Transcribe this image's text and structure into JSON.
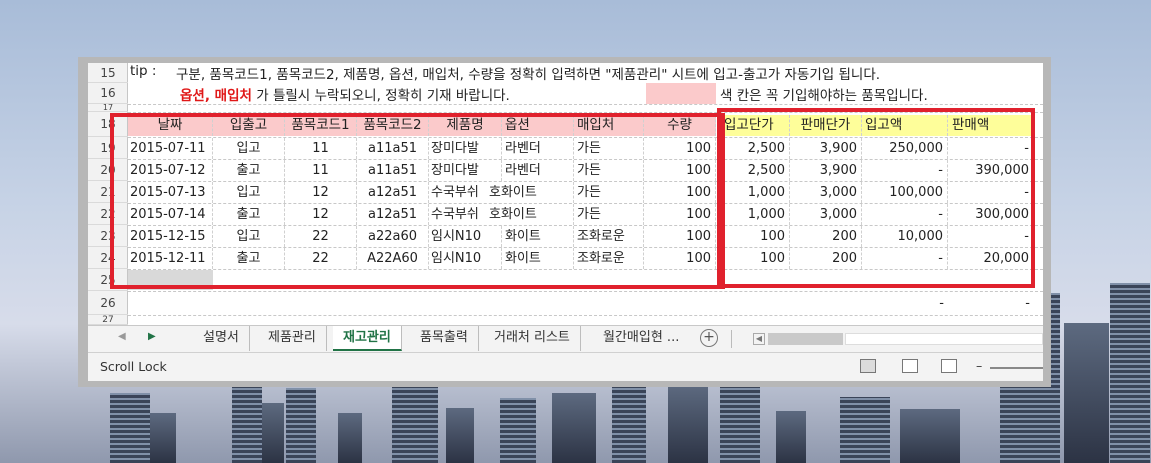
{
  "tip_label": "tip  :",
  "tip_line1": "구분, 품목코드1, 품목코드2, 제품명, 옵션, 매입처, 수량을 정확히 입력하면 \"제품관리\" 시트에 입고-출고가 자동기입 됩니다.",
  "tip_line2_red": "옵션, 매입처",
  "tip_line2_rest": " 가 틀릴시 누락되오니, 정확히 기재 바랍니다.",
  "tip_line2_right": "색 칸은 꼭 기입해야하는 품목입니다.",
  "row_numbers": [
    "15",
    "16",
    "17",
    "18",
    "19",
    "20",
    "21",
    "22",
    "23",
    "24",
    "25",
    "26",
    "27"
  ],
  "headers": {
    "date": "날짜",
    "inout": "입출고",
    "code1": "품목코드1",
    "code2": "품목코드2",
    "product": "제품명",
    "option": "옵션",
    "vendor": "매입처",
    "qty": "수량",
    "in_price": "입고단가",
    "sale_price": "판매단가",
    "in_amount": "입고액",
    "sale_amount": "판매액"
  },
  "rows": [
    {
      "date": "2015-07-11",
      "inout": "입고",
      "code1": "11",
      "code2": "a11a51",
      "product": "장미다발",
      "option": "라벤더",
      "vendor": "가든",
      "qty": "100",
      "in_price": "2,500",
      "sale_price": "3,900",
      "in_amount": "250,000",
      "sale_amount": "-"
    },
    {
      "date": "2015-07-12",
      "inout": "출고",
      "code1": "11",
      "code2": "a11a51",
      "product": "장미다발",
      "option": "라벤더",
      "vendor": "가든",
      "qty": "100",
      "in_price": "2,500",
      "sale_price": "3,900",
      "in_amount": "-",
      "sale_amount": "390,000"
    },
    {
      "date": "2015-07-13",
      "inout": "입고",
      "code1": "12",
      "code2": "a12a51",
      "product": "수국부쉬",
      "option": "호화이트",
      "vendor": "가든",
      "qty": "100",
      "in_price": "1,000",
      "sale_price": "3,000",
      "in_amount": "100,000",
      "sale_amount": "-"
    },
    {
      "date": "2015-07-14",
      "inout": "출고",
      "code1": "12",
      "code2": "a12a51",
      "product": "수국부쉬",
      "option": "호화이트",
      "vendor": "가든",
      "qty": "100",
      "in_price": "1,000",
      "sale_price": "3,000",
      "in_amount": "-",
      "sale_amount": "300,000"
    },
    {
      "date": "2015-12-15",
      "inout": "입고",
      "code1": "22",
      "code2": "a22a60",
      "product": "임시N10",
      "option": "화이트",
      "vendor": "조화로운",
      "qty": "100",
      "in_price": "100",
      "sale_price": "200",
      "in_amount": "10,000",
      "sale_amount": "-"
    },
    {
      "date": "2015-12-11",
      "inout": "출고",
      "code1": "22",
      "code2": "A22A60",
      "product": "임시N10",
      "option": "화이트",
      "vendor": "조화로운",
      "qty": "100",
      "in_price": "100",
      "sale_price": "200",
      "in_amount": "-",
      "sale_amount": "20,000"
    }
  ],
  "row26": {
    "in_amount": "-",
    "sale_amount": "-"
  },
  "tabs": [
    "설명서",
    "제품관리",
    "재고관리",
    "품목출력",
    "거래처 리스트",
    "월간매입현 ..."
  ],
  "active_tab": "재고관리",
  "status_text": "Scroll Lock",
  "zoom_minus": "–",
  "colors": {
    "header_pink": "#fbcacb",
    "header_yellow": "#fefe9a",
    "highlight_red": "#e0212d",
    "excel_green": "#217346"
  }
}
